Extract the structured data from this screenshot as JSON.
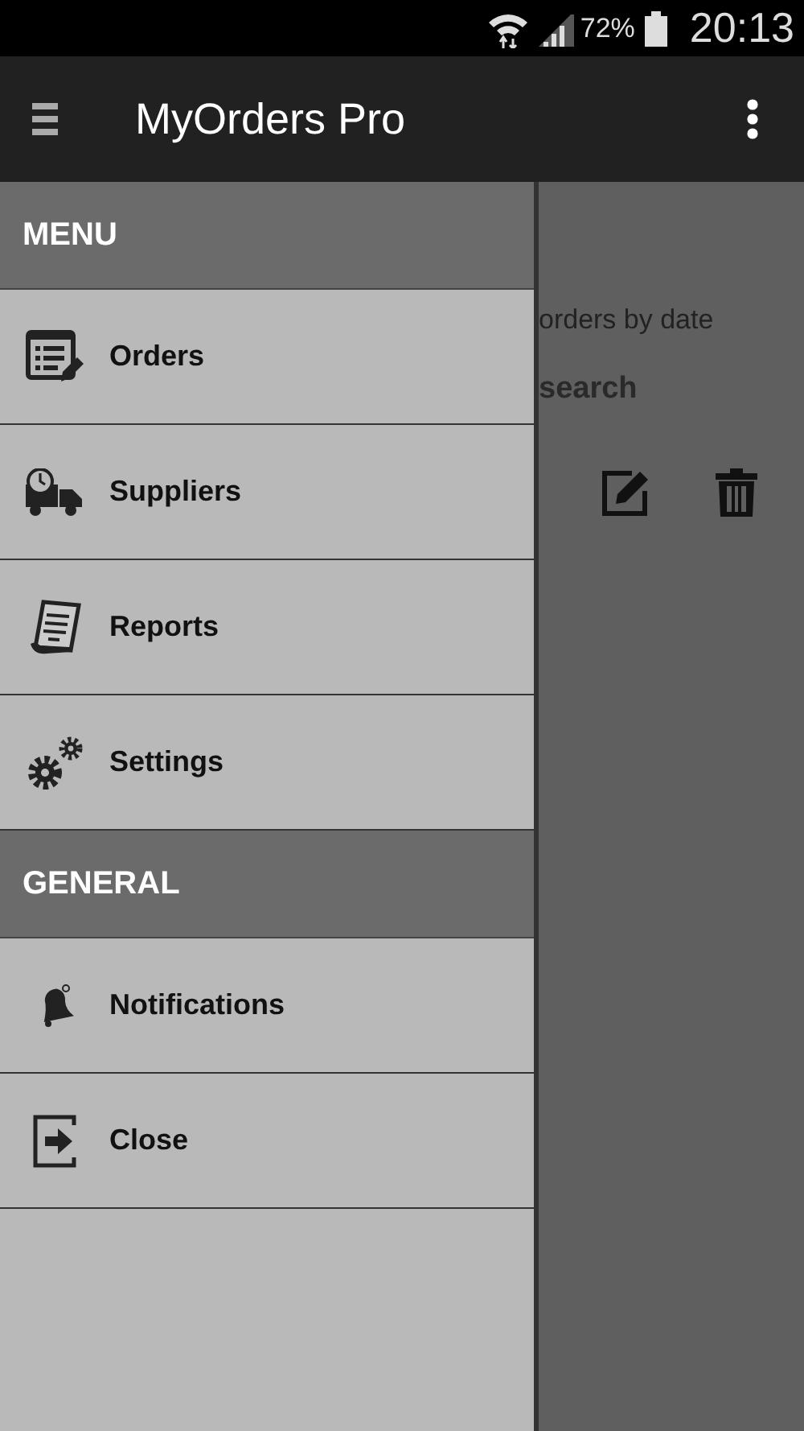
{
  "status_bar": {
    "battery_percent": "72%",
    "time": "20:13"
  },
  "app_bar": {
    "title": "MyOrders Pro"
  },
  "background_page": {
    "radio_label": "orders by date",
    "search_label": "search"
  },
  "drawer": {
    "sections": [
      {
        "title": "MENU",
        "items": [
          {
            "label": "Orders",
            "kind": "orders"
          },
          {
            "label": "Suppliers",
            "kind": "suppliers"
          },
          {
            "label": "Reports",
            "kind": "reports"
          },
          {
            "label": "Settings",
            "kind": "settings"
          }
        ]
      },
      {
        "title": "GENERAL",
        "items": [
          {
            "label": "Notifications",
            "kind": "notifications"
          },
          {
            "label": "Close",
            "kind": "close"
          }
        ]
      }
    ]
  }
}
